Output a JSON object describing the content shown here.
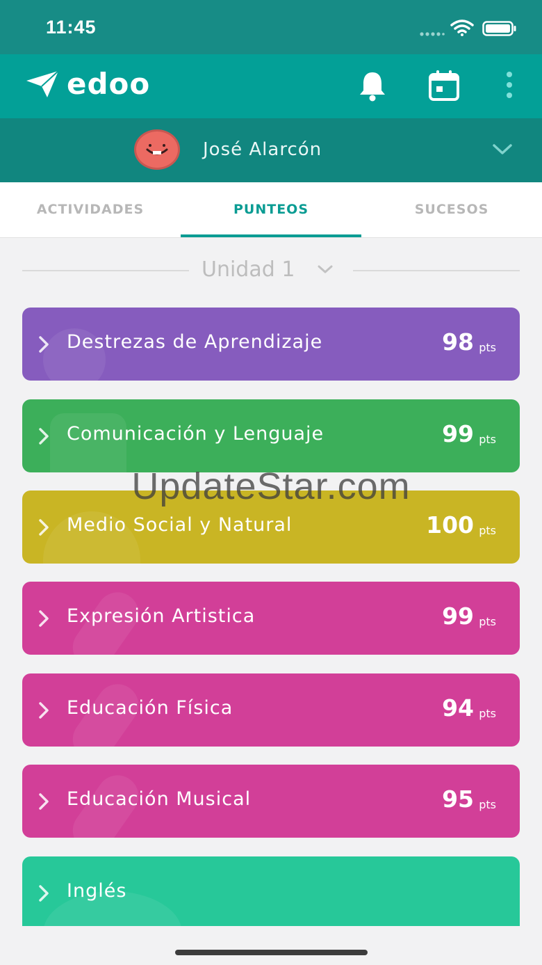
{
  "status_bar": {
    "time": "11:45"
  },
  "header": {
    "app_name": "edoo",
    "icons": [
      "paper-plane-icon",
      "bell-icon",
      "calendar-icon",
      "more-vertical-icon"
    ]
  },
  "profile": {
    "name": "José Alarcón"
  },
  "tabs": [
    {
      "label": "ACTIVIDADES",
      "active": false
    },
    {
      "label": "PUNTEOS",
      "active": true
    },
    {
      "label": "SUCESOS",
      "active": false
    }
  ],
  "unit_selector": {
    "label": "Unidad 1"
  },
  "subjects": [
    {
      "title": "Destrezas de Aprendizaje",
      "score": "98",
      "unit": "pts",
      "color": "#865cbe"
    },
    {
      "title": "Comunicación y Lenguaje",
      "score": "99",
      "unit": "pts",
      "color": "#3caf5a"
    },
    {
      "title": "Medio Social y Natural",
      "score": "100",
      "unit": "pts",
      "color": "#c9b524"
    },
    {
      "title": "Expresión Artistica",
      "score": "99",
      "unit": "pts",
      "color": "#d23f98"
    },
    {
      "title": "Educación Física",
      "score": "94",
      "unit": "pts",
      "color": "#d23f98"
    },
    {
      "title": "Educación  Musical",
      "score": "95",
      "unit": "pts",
      "color": "#d23f98"
    },
    {
      "title": "Inglés",
      "score": "",
      "unit": "",
      "color": "#27c899"
    }
  ],
  "watermark": "UpdateStar.com"
}
